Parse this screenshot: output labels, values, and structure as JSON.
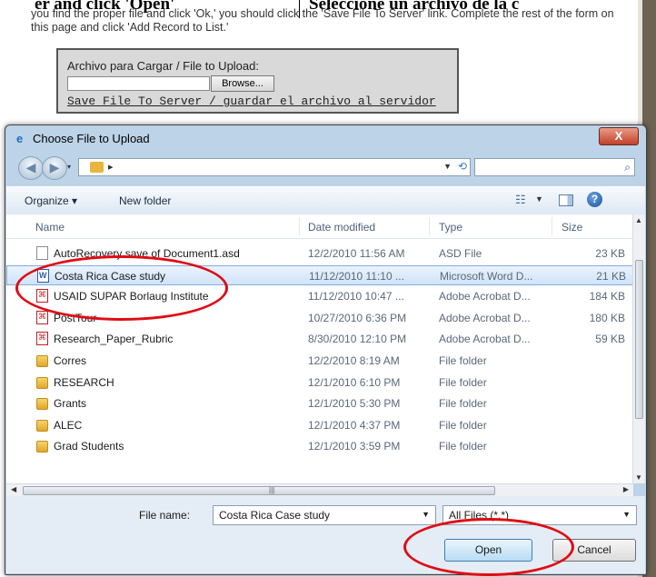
{
  "page": {
    "header_left": "er and click 'Open'",
    "header_right": "Seleccione un archivo de la c",
    "instructions": "you find the proper file and click 'Ok,' you should click the 'Save File To Server' link. Complete the rest of the form on this page and click 'Add Record to List.'",
    "upload_label": "Archivo para Cargar / File to Upload:",
    "browse_label": "Browse...",
    "save_link": "Save File To Server / guardar el archivo al servidor"
  },
  "dialog": {
    "title": "Choose File to Upload",
    "close_label": "X",
    "toolbar": {
      "organize": "Organize ▾",
      "new_folder": "New folder"
    },
    "columns": {
      "name": "Name",
      "date": "Date modified",
      "type": "Type",
      "size": "Size"
    },
    "files": [
      {
        "name": "AutoRecovery save of Document1.asd",
        "date": "12/2/2010 11:56 AM",
        "type": "ASD File",
        "size": "23 KB",
        "icon": "doc",
        "selected": false
      },
      {
        "name": "Costa Rica Case study",
        "date": "11/12/2010 11:10 ...",
        "type": "Microsoft Word D...",
        "size": "21 KB",
        "icon": "word",
        "selected": true
      },
      {
        "name": "USAID SUPAR Borlaug Institute",
        "date": "11/12/2010 10:47 ...",
        "type": "Adobe Acrobat D...",
        "size": "184 KB",
        "icon": "pdf",
        "selected": false
      },
      {
        "name": "PostTour",
        "date": "10/27/2010 6:36 PM",
        "type": "Adobe Acrobat D...",
        "size": "180 KB",
        "icon": "pdf",
        "selected": false
      },
      {
        "name": "Research_Paper_Rubric",
        "date": "8/30/2010 12:10 PM",
        "type": "Adobe Acrobat D...",
        "size": "59 KB",
        "icon": "pdf",
        "selected": false
      },
      {
        "name": "Corres",
        "date": "12/2/2010 8:19 AM",
        "type": "File folder",
        "size": "",
        "icon": "folder",
        "selected": false
      },
      {
        "name": "RESEARCH",
        "date": "12/1/2010 6:10 PM",
        "type": "File folder",
        "size": "",
        "icon": "folder",
        "selected": false
      },
      {
        "name": "Grants",
        "date": "12/1/2010 5:30 PM",
        "type": "File folder",
        "size": "",
        "icon": "folder",
        "selected": false
      },
      {
        "name": "ALEC",
        "date": "12/1/2010 4:37 PM",
        "type": "File folder",
        "size": "",
        "icon": "folder",
        "selected": false
      },
      {
        "name": "Grad Students",
        "date": "12/1/2010 3:59 PM",
        "type": "File folder",
        "size": "",
        "icon": "folder",
        "selected": false
      }
    ],
    "file_name_label": "File name:",
    "file_name_value": "Costa Rica Case study",
    "file_type_value": "All Files (*.*)",
    "open_label": "Open",
    "cancel_label": "Cancel"
  },
  "annotation_color": "#e00b14"
}
